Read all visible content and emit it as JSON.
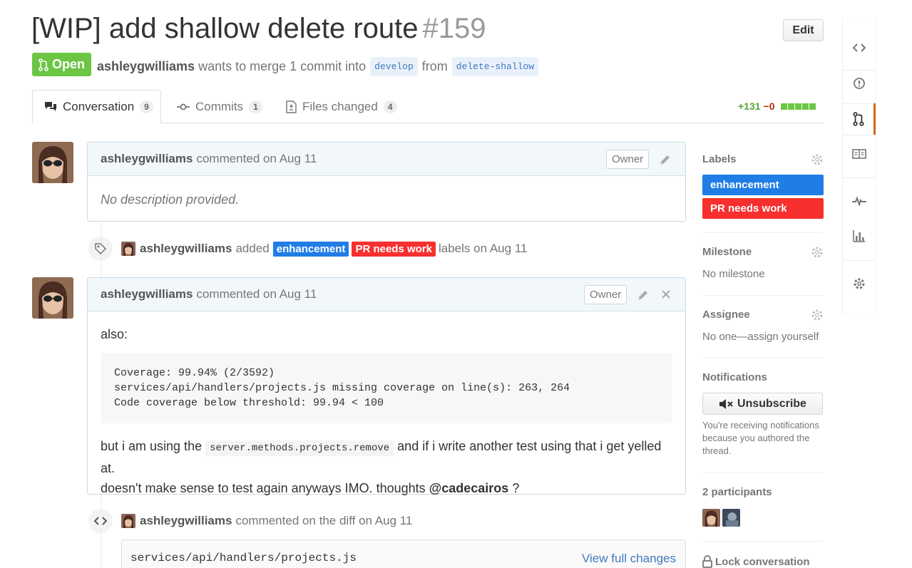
{
  "header": {
    "title": "[WIP] add shallow delete route",
    "number": "#159",
    "edit_label": "Edit",
    "state_label": "Open",
    "author": "ashleygwilliams",
    "merge_text": "wants to merge 1 commit into",
    "base_branch": "develop",
    "from_text": "from",
    "head_branch": "delete-shallow"
  },
  "tabs": [
    {
      "label": "Conversation",
      "count": "9"
    },
    {
      "label": "Commits",
      "count": "1"
    },
    {
      "label": "Files changed",
      "count": "4"
    }
  ],
  "diffstat": {
    "additions": "+131",
    "deletions": "−0",
    "blocks": 5,
    "add_color": "#6cc644"
  },
  "comments": [
    {
      "author": "ashleygwilliams",
      "meta": "commented on Aug 11",
      "badge": "Owner",
      "body": "No description provided."
    },
    {
      "author": "ashleygwilliams",
      "meta": "commented on Aug 11",
      "badge": "Owner",
      "intro": "also:",
      "code_lines": [
        "Coverage: 99.94% (2/3592)",
        "services/api/handlers/projects.js missing coverage on line(s): 263, 264",
        "Code coverage below threshold: 99.94 < 100"
      ],
      "text_before_code": "but i am using the",
      "inline_code": "server.methods.projects.remove",
      "text_after_code": "and if i write another test using that i get yelled at.",
      "line2": "doesn't make sense to test again anyways IMO. thoughts",
      "mention": "@cadecairos",
      "line2_end": "?"
    }
  ],
  "label_event": {
    "author": "ashleygwilliams",
    "verb": "added",
    "labels": [
      {
        "name": "enhancement",
        "color": "#207de5"
      },
      {
        "name": "PR needs work",
        "color": "#f72f2f"
      }
    ],
    "suffix": "labels on Aug 11"
  },
  "diff_event": {
    "author": "ashleygwilliams",
    "text": "commented on the diff on Aug 11",
    "file": "services/api/handlers/projects.js",
    "view_link": "View full changes"
  },
  "sidebar": {
    "labels_title": "Labels",
    "labels": [
      {
        "name": "enhancement",
        "color": "#207de5"
      },
      {
        "name": "PR needs work",
        "color": "#f72f2f"
      }
    ],
    "milestone_title": "Milestone",
    "milestone_value": "No milestone",
    "assignee_title": "Assignee",
    "assignee_value": "No one—assign yourself",
    "notifications_title": "Notifications",
    "unsubscribe_label": "Unsubscribe",
    "notifications_reason": "You're receiving notifications because you authored the thread.",
    "participants_title": "2 participants",
    "lock_label": "Lock conversation"
  },
  "right_nav": [
    "code-icon",
    "issue-opened-icon",
    "git-pull-request-icon",
    "book-icon",
    "pulse-icon",
    "graph-icon",
    "gear-icon"
  ]
}
